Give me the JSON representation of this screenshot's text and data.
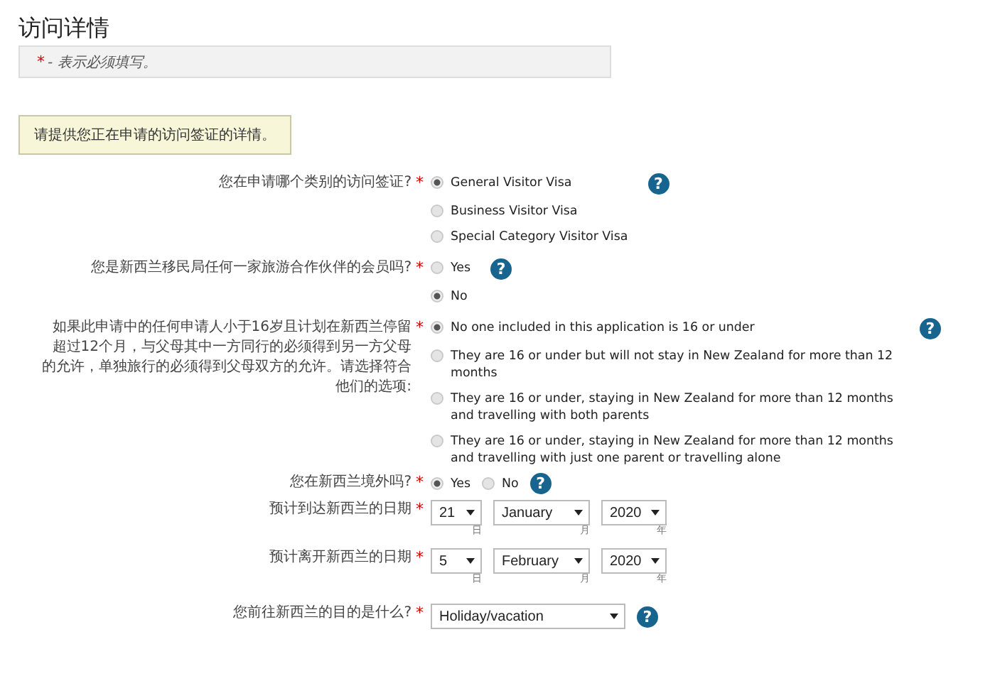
{
  "title": "访问详情",
  "required_note": {
    "mark": "*",
    "text": "- 表示必须填写。"
  },
  "instruction": "请提供您正在申请的访问签证的详情。",
  "questions": [
    {
      "kind": "radio",
      "label": "您在申请哪个类别的访问签证?",
      "mark": "*",
      "help": "?",
      "inline": false,
      "options": [
        {
          "label": "General Visitor Visa",
          "selected": true
        },
        {
          "label": "Business Visitor Visa",
          "selected": false
        },
        {
          "label": "Special Category Visitor Visa",
          "selected": false
        }
      ]
    },
    {
      "kind": "radio",
      "label": "您是新西兰移民局任何一家旅游合作伙伴的会员吗?",
      "mark": "*",
      "help": "?",
      "inline": false,
      "options": [
        {
          "label": "Yes",
          "selected": false
        },
        {
          "label": "No",
          "selected": true
        }
      ]
    },
    {
      "kind": "radio",
      "label": "如果此申请中的任何申请人小于16岁且计划在新西兰停留超过12个月，与父母其中一方同行的必须得到另一方父母的允许，单独旅行的必须得到父母双方的允许。请选择符合他们的选项:",
      "mark": "*",
      "help": "?",
      "inline": false,
      "options": [
        {
          "label": "No one included in this application is 16 or under",
          "selected": true
        },
        {
          "label": "They are 16 or under but will not stay in New Zealand for more than 12 months",
          "selected": false
        },
        {
          "label": "They are 16 or under, staying in New Zealand for more than 12 months and travelling with both parents",
          "selected": false
        },
        {
          "label": "They are 16 or under, staying in New Zealand for more than 12 months and travelling with just one parent or travelling alone",
          "selected": false
        }
      ]
    },
    {
      "kind": "radio",
      "label": "您在新西兰境外吗?",
      "mark": "*",
      "help": "?",
      "inline": true,
      "options": [
        {
          "label": "Yes",
          "selected": true
        },
        {
          "label": "No",
          "selected": false
        }
      ]
    },
    {
      "kind": "date",
      "label": "预计到达新西兰的日期",
      "mark": "*",
      "fields": [
        {
          "value": "21",
          "unit": "日"
        },
        {
          "value": "January",
          "unit": "月"
        },
        {
          "value": "2020",
          "unit": "年"
        }
      ]
    },
    {
      "kind": "date",
      "label": "预计离开新西兰的日期",
      "mark": "*",
      "fields": [
        {
          "value": "5",
          "unit": "日"
        },
        {
          "value": "February",
          "unit": "月"
        },
        {
          "value": "2020",
          "unit": "年"
        }
      ]
    },
    {
      "kind": "select",
      "label": "您前往新西兰的目的是什么?",
      "mark": "*",
      "help": "?",
      "value": "Holiday/vacation"
    }
  ]
}
